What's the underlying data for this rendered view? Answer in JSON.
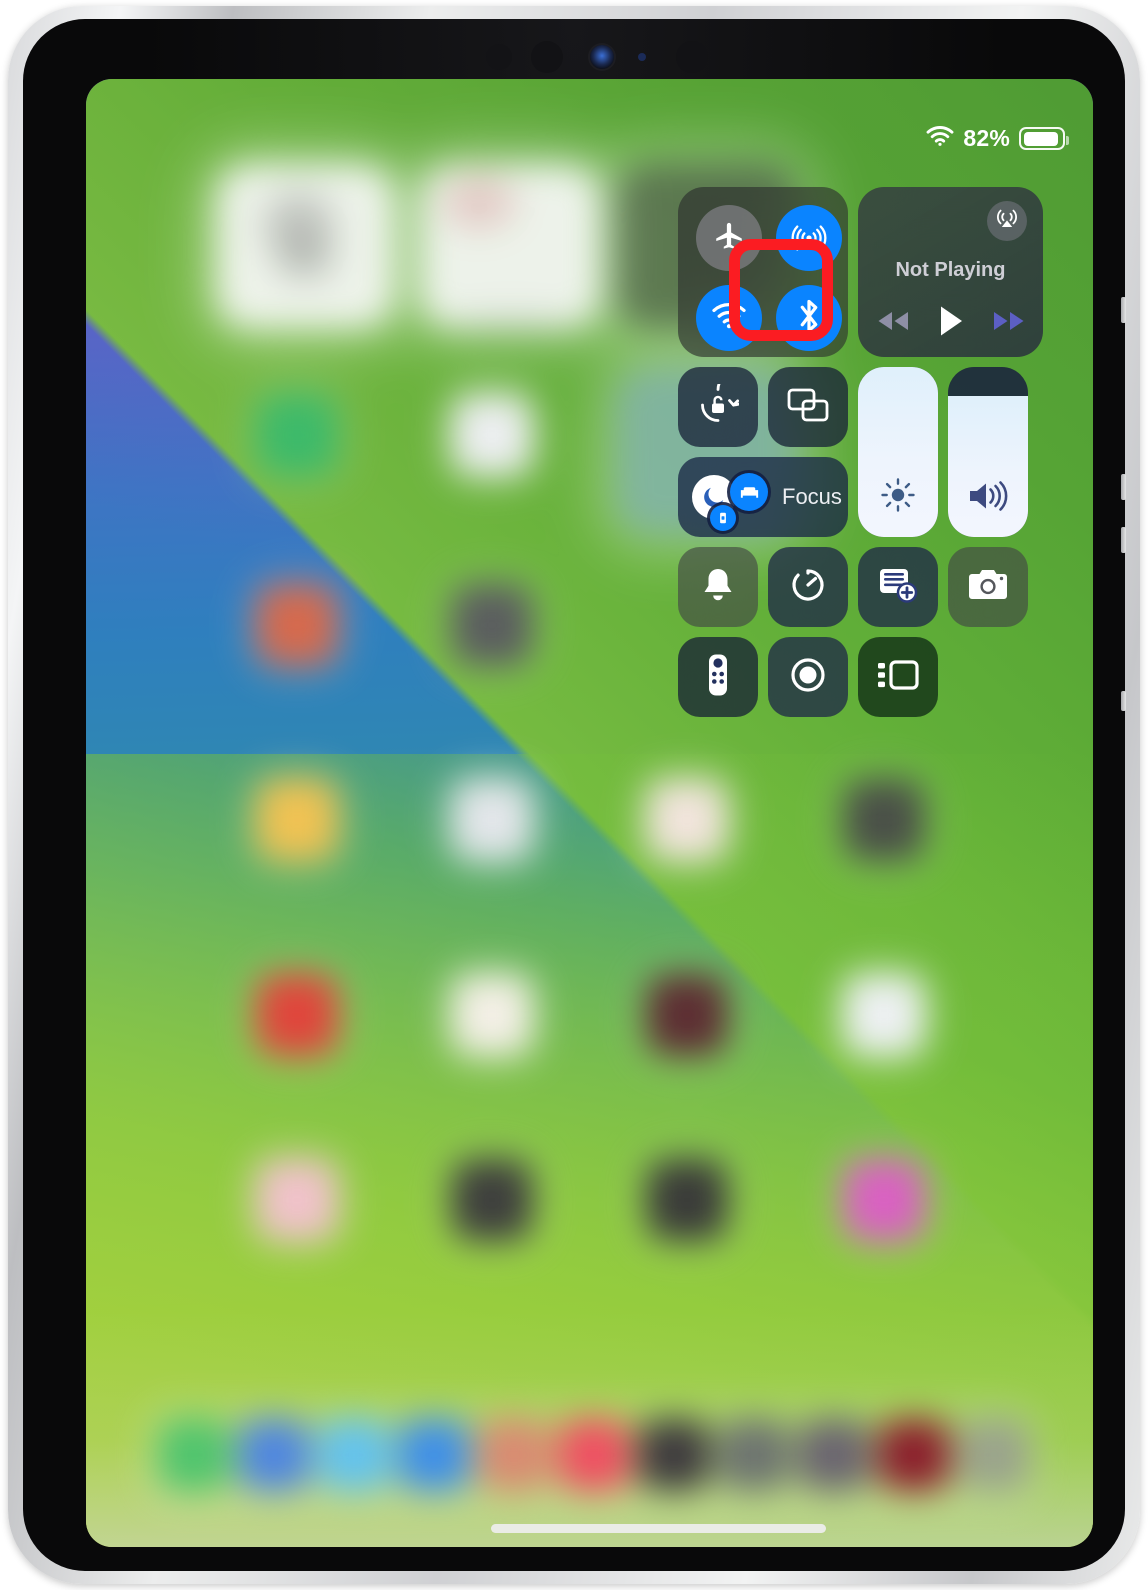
{
  "device": {
    "name": "iPad Pro",
    "orientation": "portrait"
  },
  "status_bar": {
    "wifi_icon": "wifi-icon",
    "battery_percent": "82%",
    "battery_level": 82,
    "battery_icon": "battery-icon"
  },
  "control_center": {
    "connectivity": {
      "airplane_mode": {
        "label": "Airplane Mode",
        "icon": "airplane-icon",
        "state": "off"
      },
      "airdrop": {
        "label": "AirDrop",
        "icon": "airdrop-icon",
        "state": "on"
      },
      "wifi": {
        "label": "Wi-Fi",
        "icon": "wifi-icon",
        "state": "on"
      },
      "bluetooth": {
        "label": "Bluetooth",
        "icon": "bluetooth-icon",
        "state": "on",
        "highlighted": true
      }
    },
    "media": {
      "now_playing": "Not Playing",
      "airplay_icon": "airplay-icon",
      "rewind_icon": "rewind-icon",
      "play_icon": "play-icon",
      "forward_icon": "fast-forward-icon"
    },
    "rotation_lock": {
      "label": "Rotation Lock",
      "icon": "rotation-lock-icon"
    },
    "screen_mirroring": {
      "label": "Screen Mirroring",
      "icon": "screen-mirroring-icon"
    },
    "focus": {
      "label": "Focus",
      "badges": [
        "do-not-disturb-icon",
        "sleep-icon",
        "reading-icon"
      ]
    },
    "brightness": {
      "label": "Brightness",
      "icon": "brightness-icon",
      "value": 100
    },
    "volume": {
      "label": "Volume",
      "icon": "volume-icon",
      "value": 83
    },
    "alarm": {
      "label": "Alarm",
      "icon": "alarm-bell-icon"
    },
    "timer": {
      "label": "Timer",
      "icon": "timer-icon"
    },
    "quick_note": {
      "label": "Quick Note",
      "icon": "quick-note-icon"
    },
    "camera": {
      "label": "Camera",
      "icon": "camera-icon"
    },
    "apple_tv_remote": {
      "label": "Apple TV Remote",
      "icon": "tv-remote-icon"
    },
    "screen_recording": {
      "label": "Screen Recording",
      "icon": "screen-record-icon"
    },
    "stage_manager": {
      "label": "Stage Manager",
      "icon": "stage-manager-icon"
    }
  },
  "highlight": {
    "target": "bluetooth-toggle",
    "color": "#fb1c22"
  },
  "home_screen": {
    "home_indicator": "home-indicator",
    "widgets_count": 2,
    "dock_icons_count": 11
  }
}
